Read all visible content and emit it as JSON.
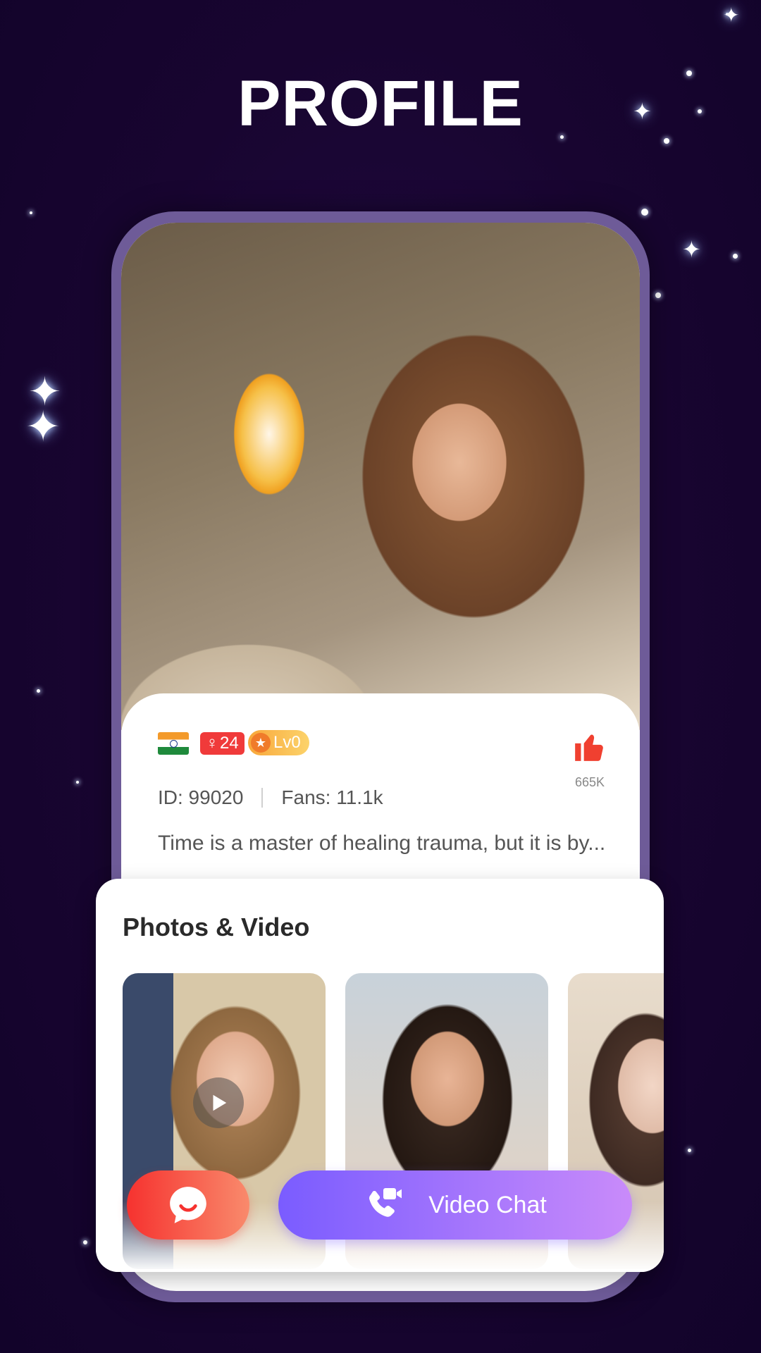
{
  "page": {
    "title": "PROFILE"
  },
  "profile": {
    "flag": "india-flag",
    "age_badge": "24",
    "level_badge": "Lv0",
    "likes": "665K",
    "id_text": "ID: 99020",
    "fans_text": "Fans: 11.1k",
    "bio": "Time is a master of healing trauma, but it is by..."
  },
  "media": {
    "title": "Photos & Video",
    "thumbs": [
      "video-thumb",
      "photo-thumb",
      "photo-thumb"
    ]
  },
  "actions": {
    "chat_icon": "message-icon",
    "video_chat_label": "Video Chat"
  },
  "colors": {
    "background": "#1a0733",
    "frame": "#6e5b98",
    "chat_button": "#f6322f",
    "video_button_start": "#7a5cff",
    "video_button_end": "#c98bfa",
    "age_badge": "#f03a3a",
    "level_badge": "#f8a73a",
    "like": "#f04030"
  }
}
